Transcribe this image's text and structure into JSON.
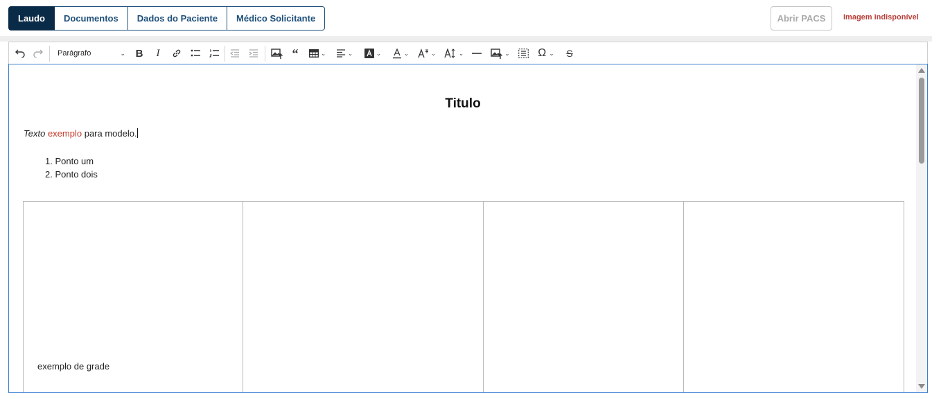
{
  "header": {
    "tabs": [
      {
        "label": "Laudo",
        "active": true
      },
      {
        "label": "Documentos",
        "active": false
      },
      {
        "label": "Dados do Paciente",
        "active": false
      },
      {
        "label": "Médico Solicitante",
        "active": false
      }
    ],
    "open_pacs_label": "Abrir PACS",
    "image_status": "Imagem indisponível"
  },
  "toolbar": {
    "paragraph_format": "Parágrafo",
    "icons": [
      "undo-icon",
      "redo-icon",
      "bold-icon",
      "italic-icon",
      "link-icon",
      "bulleted-list-icon",
      "numbered-list-icon",
      "outdent-icon",
      "indent-icon",
      "insert-image-icon",
      "blockquote-icon",
      "table-icon",
      "align-icon",
      "font-background-color-icon",
      "font-color-icon",
      "font-size-icon",
      "line-height-icon",
      "horizontal-line-icon",
      "image-upload-icon",
      "select-all-icon",
      "special-characters-icon",
      "strikethrough-icon"
    ]
  },
  "document": {
    "title": "Titulo",
    "paragraph": {
      "italic": "Texto",
      "red": "exemplo",
      "rest": "para modelo."
    },
    "list": [
      "1. Ponto um",
      "2. Ponto dois"
    ],
    "table_cell_text": "exemplo de grade"
  },
  "colors": {
    "active_tab": "#0a2b47",
    "tab_text": "#1d4f7a",
    "status_red": "#b8403a",
    "editor_focus": "#3b7fd0"
  }
}
